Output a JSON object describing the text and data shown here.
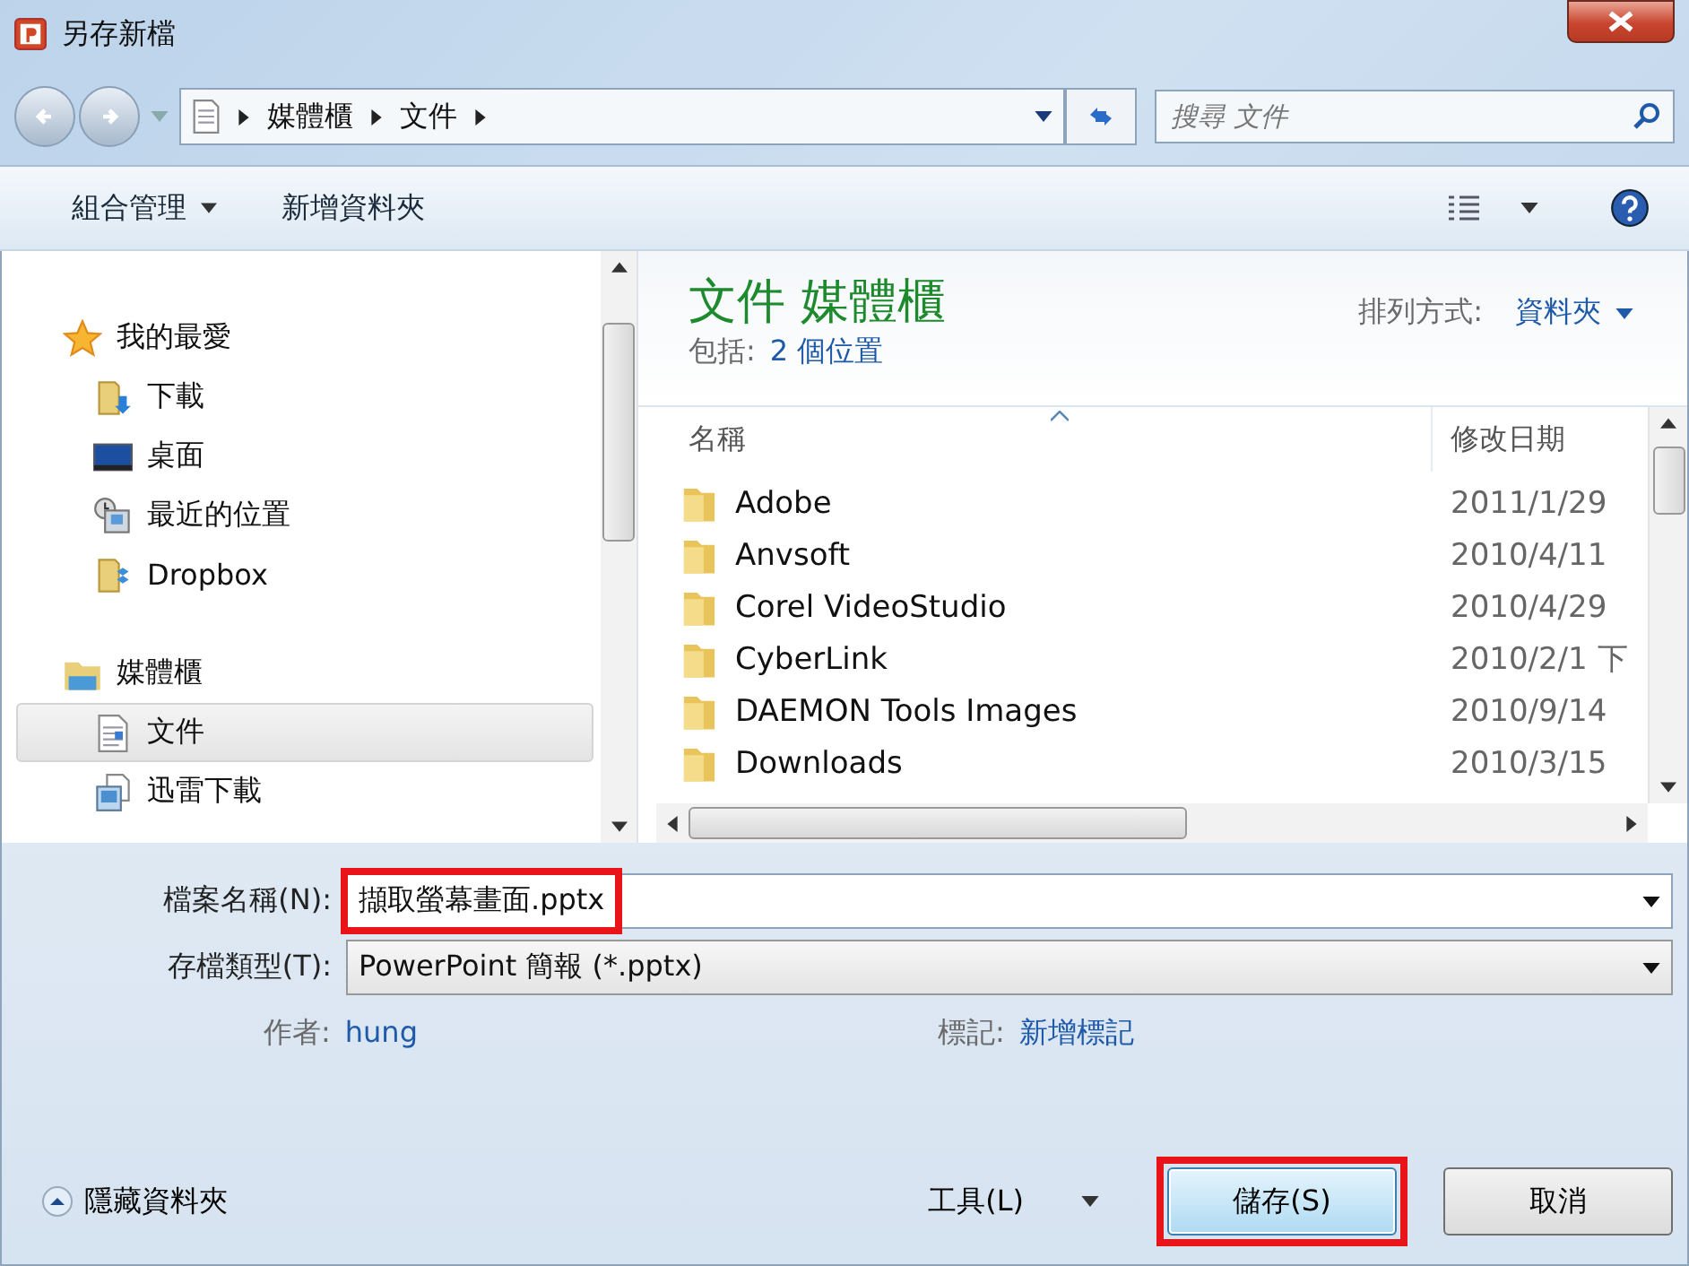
{
  "window": {
    "title": "另存新檔"
  },
  "address": {
    "crumbs": [
      "媒體櫃",
      "文件"
    ],
    "search_placeholder": "搜尋 文件"
  },
  "toolbar": {
    "organize": "組合管理",
    "new_folder": "新增資料夾"
  },
  "sidebar": {
    "groups": [
      {
        "label": "我的最愛",
        "kind": "star",
        "children": [
          {
            "label": "下載",
            "kind": "download",
            "selected": false
          },
          {
            "label": "桌面",
            "kind": "desktop",
            "selected": false
          },
          {
            "label": "最近的位置",
            "kind": "recent",
            "selected": false
          },
          {
            "label": "Dropbox",
            "kind": "dropbox",
            "selected": false
          }
        ]
      },
      {
        "label": "媒體櫃",
        "kind": "library",
        "children": [
          {
            "label": "文件",
            "kind": "document",
            "selected": true
          },
          {
            "label": "迅雷下載",
            "kind": "download2",
            "selected": false
          }
        ]
      }
    ]
  },
  "library": {
    "title": "文件 媒體櫃",
    "includes_label": "包括:",
    "includes_link": "2 個位置",
    "arrange_label": "排列方式:",
    "arrange_value": "資料夾"
  },
  "table": {
    "columns": [
      "名稱",
      "修改日期"
    ],
    "rows": [
      {
        "name": "Adobe",
        "date": "2011/1/29"
      },
      {
        "name": "Anvsoft",
        "date": "2010/4/11"
      },
      {
        "name": "Corel VideoStudio",
        "date": "2010/4/29"
      },
      {
        "name": "CyberLink",
        "date": "2010/2/1 下"
      },
      {
        "name": "DAEMON Tools Images",
        "date": "2010/9/14"
      },
      {
        "name": "Downloads",
        "date": "2010/3/15"
      }
    ]
  },
  "form": {
    "filename_label": "檔案名稱(N):",
    "filename_value": "擷取螢幕畫面.pptx",
    "filename_highlighted": true,
    "type_label": "存檔類型(T):",
    "type_value": "PowerPoint 簡報 (*.pptx)",
    "author_label": "作者:",
    "author_value": "hung",
    "tags_label": "標記:",
    "tags_value": "新增標記"
  },
  "footer": {
    "hide_folders": "隱藏資料夾",
    "tools": "工具(L)",
    "save": "儲存(S)",
    "save_highlighted": true,
    "cancel": "取消"
  }
}
